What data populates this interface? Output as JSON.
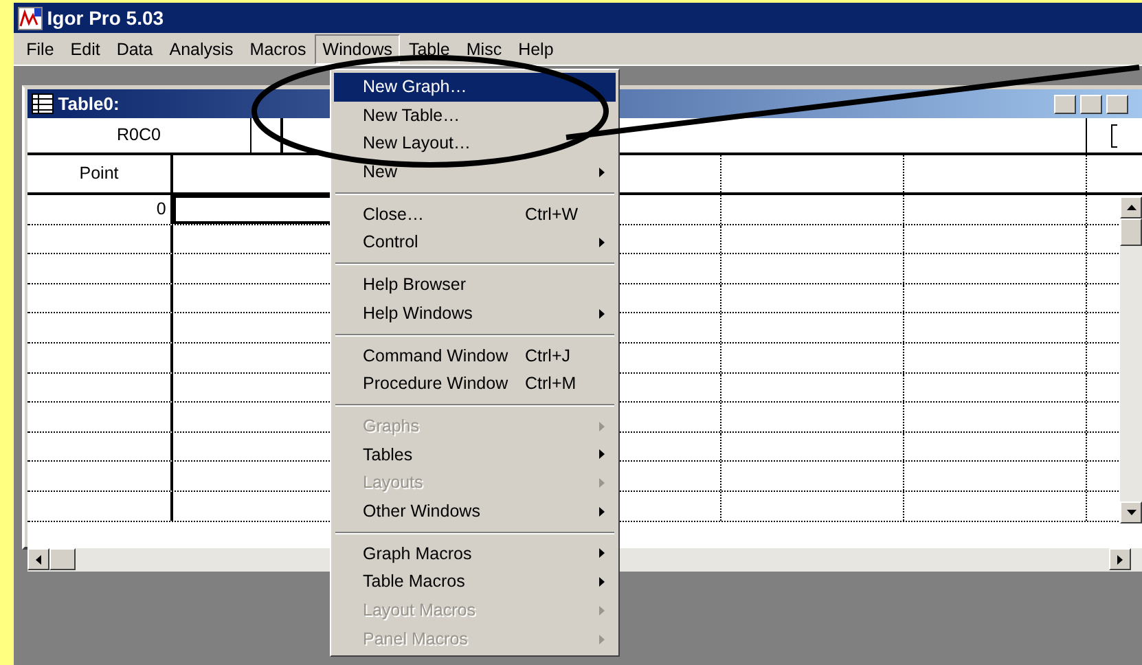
{
  "app": {
    "title": "Igor Pro 5.03"
  },
  "menu_bar": [
    {
      "label": "File",
      "selected": false
    },
    {
      "label": "Edit",
      "selected": false
    },
    {
      "label": "Data",
      "selected": false
    },
    {
      "label": "Analysis",
      "selected": false
    },
    {
      "label": "Macros",
      "selected": false
    },
    {
      "label": "Windows",
      "selected": true
    },
    {
      "label": "Table",
      "selected": false
    },
    {
      "label": "Misc",
      "selected": false
    },
    {
      "label": "Help",
      "selected": false
    }
  ],
  "table_window": {
    "title": "Table0:",
    "header_cell": "R0C0",
    "index_column": "Point",
    "rows": [
      {
        "point": "0"
      }
    ]
  },
  "windows_menu": [
    {
      "kind": "item",
      "label": "New Graph…",
      "selected": true,
      "disabled": false,
      "submenu": false
    },
    {
      "kind": "item",
      "label": "New Table…",
      "selected": false,
      "disabled": false,
      "submenu": false
    },
    {
      "kind": "item",
      "label": "New Layout…",
      "selected": false,
      "disabled": false,
      "submenu": false
    },
    {
      "kind": "item",
      "label": "New",
      "selected": false,
      "disabled": false,
      "submenu": true
    },
    {
      "kind": "separator"
    },
    {
      "kind": "item",
      "label": "Close…",
      "shortcut": "Ctrl+W",
      "selected": false,
      "disabled": false,
      "submenu": false
    },
    {
      "kind": "item",
      "label": "Control",
      "selected": false,
      "disabled": false,
      "submenu": true
    },
    {
      "kind": "separator"
    },
    {
      "kind": "item",
      "label": "Help Browser",
      "selected": false,
      "disabled": false,
      "submenu": false
    },
    {
      "kind": "item",
      "label": "Help Windows",
      "selected": false,
      "disabled": false,
      "submenu": true
    },
    {
      "kind": "separator"
    },
    {
      "kind": "item",
      "label": "Command Window",
      "shortcut": "Ctrl+J",
      "selected": false,
      "disabled": false,
      "submenu": false
    },
    {
      "kind": "item",
      "label": "Procedure Window",
      "shortcut": "Ctrl+M",
      "selected": false,
      "disabled": false,
      "submenu": false
    },
    {
      "kind": "separator"
    },
    {
      "kind": "item",
      "label": "Graphs",
      "selected": false,
      "disabled": true,
      "submenu": true
    },
    {
      "kind": "item",
      "label": "Tables",
      "selected": false,
      "disabled": false,
      "submenu": true
    },
    {
      "kind": "item",
      "label": "Layouts",
      "selected": false,
      "disabled": true,
      "submenu": true
    },
    {
      "kind": "item",
      "label": "Other Windows",
      "selected": false,
      "disabled": false,
      "submenu": true
    },
    {
      "kind": "separator"
    },
    {
      "kind": "item",
      "label": "Graph Macros",
      "selected": false,
      "disabled": false,
      "submenu": true
    },
    {
      "kind": "item",
      "label": "Table Macros",
      "selected": false,
      "disabled": false,
      "submenu": true
    },
    {
      "kind": "item",
      "label": "Layout Macros",
      "selected": false,
      "disabled": true,
      "submenu": true
    },
    {
      "kind": "item",
      "label": "Panel Macros",
      "selected": false,
      "disabled": true,
      "submenu": true
    }
  ]
}
